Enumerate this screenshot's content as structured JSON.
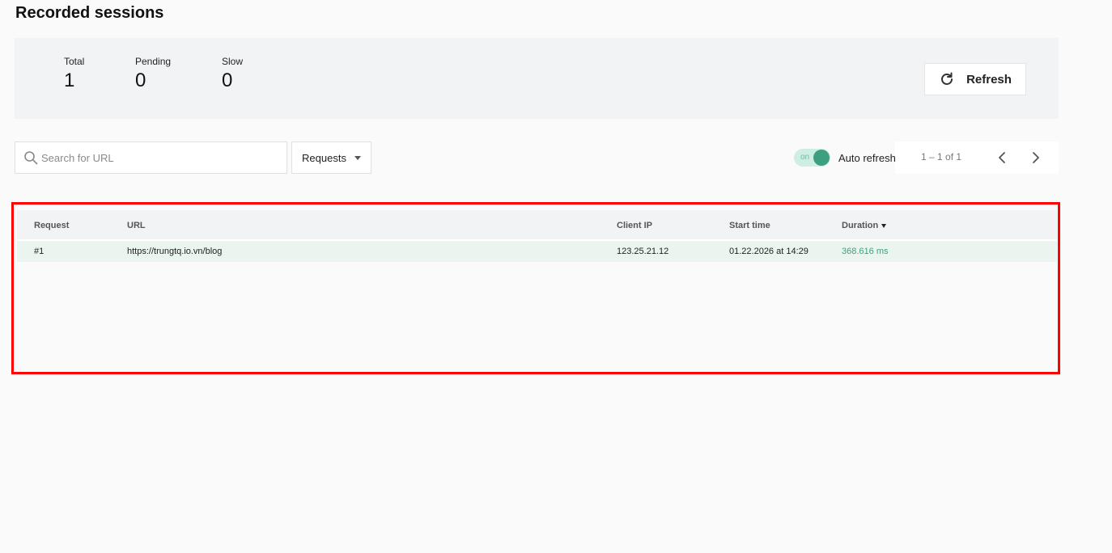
{
  "page": {
    "title": "Recorded sessions"
  },
  "stats": {
    "total": {
      "label": "Total",
      "value": "1"
    },
    "pending": {
      "label": "Pending",
      "value": "0"
    },
    "slow": {
      "label": "Slow",
      "value": "0"
    }
  },
  "toolbar": {
    "refresh_label": "Refresh",
    "search_placeholder": "Search for URL",
    "filter_selected": "Requests",
    "auto_refresh": {
      "toggle_text": "on",
      "label": "Auto refresh",
      "enabled": true
    },
    "pagination": {
      "range": "1 – 1 of 1"
    }
  },
  "table": {
    "columns": [
      "Request",
      "URL",
      "Client IP",
      "Start time",
      "Duration"
    ],
    "sorted_by": "Duration",
    "rows": [
      {
        "request": "#1",
        "url": "https://trungtq.io.vn/blog",
        "client_ip": "123.25.21.12",
        "start_time": "01.22.2026 at 14:29",
        "duration": "368.616 ms"
      }
    ]
  },
  "colors": {
    "accent": "#3e9e80",
    "duration_text": "#3aa37f",
    "row_highlight": "#e9f5ee",
    "highlight_border": "#ff0000"
  }
}
